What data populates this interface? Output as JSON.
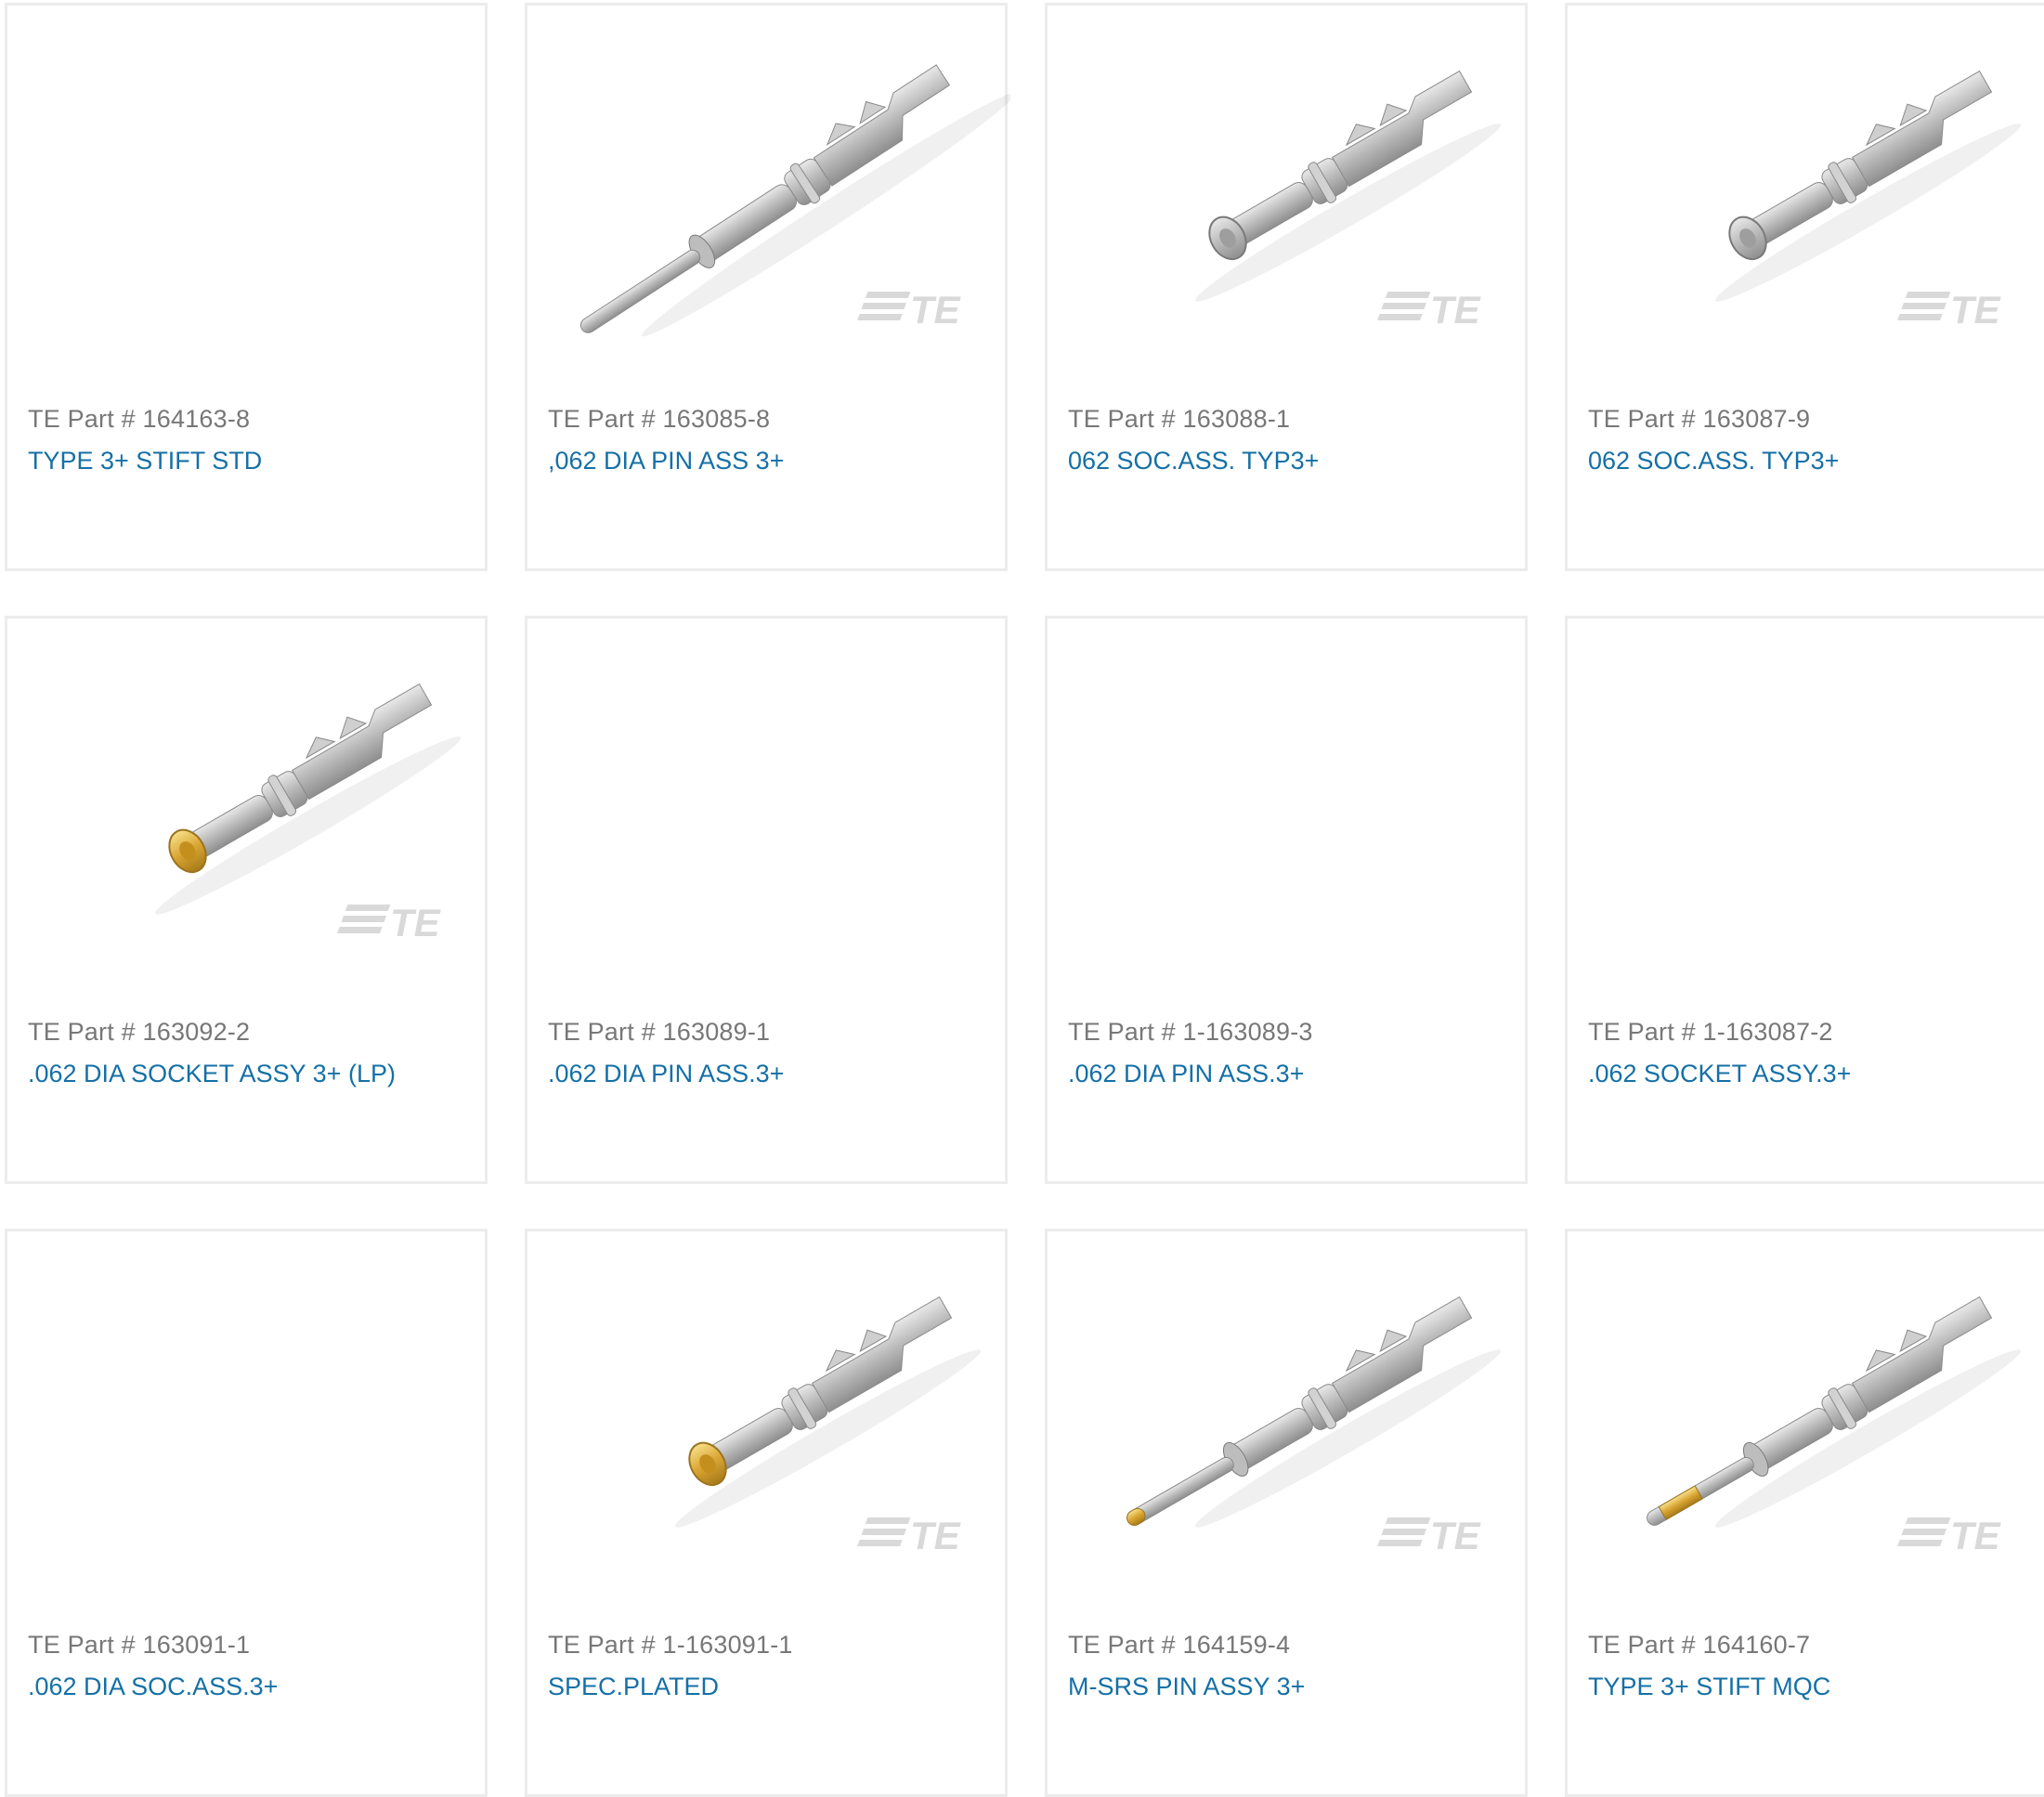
{
  "part_prefix": "TE Part # ",
  "colors": {
    "border": "#ececec",
    "part_number": "#777777",
    "description": "#1570a6",
    "watermark": "#d9d9d9"
  },
  "products": [
    {
      "part": "164163-8",
      "description": "TYPE 3+ STIFT STD",
      "image": "none"
    },
    {
      "part": "163085-8",
      "description": ",062 DIA PIN ASS 3+",
      "image": "pin-large-silver"
    },
    {
      "part": "163088-1",
      "description": "062 SOC.ASS. TYP3+",
      "image": "socket-silver"
    },
    {
      "part": "163087-9",
      "description": "062 SOC.ASS. TYP3+",
      "image": "socket-silver"
    },
    {
      "part": "163092-2",
      "description": ".062 DIA SOCKET ASSY 3+ (LP)",
      "image": "socket-gold"
    },
    {
      "part": "163089-1",
      "description": ".062 DIA PIN ASS.3+",
      "image": "none"
    },
    {
      "part": "1-163089-3",
      "description": ".062 DIA PIN ASS.3+",
      "image": "none"
    },
    {
      "part": "1-163087-2",
      "description": ".062 SOCKET ASSY.3+",
      "image": "none"
    },
    {
      "part": "163091-1",
      "description": ".062 DIA SOC.ASS.3+",
      "image": "none"
    },
    {
      "part": "1-163091-1",
      "description": "SPEC.PLATED",
      "image": "socket-gold"
    },
    {
      "part": "164159-4",
      "description": "M-SRS PIN ASSY 3+",
      "image": "pin-gold-tip"
    },
    {
      "part": "164160-7",
      "description": "TYPE 3+ STIFT MQC",
      "image": "pin-gold-band"
    }
  ],
  "watermark_text": "TE"
}
